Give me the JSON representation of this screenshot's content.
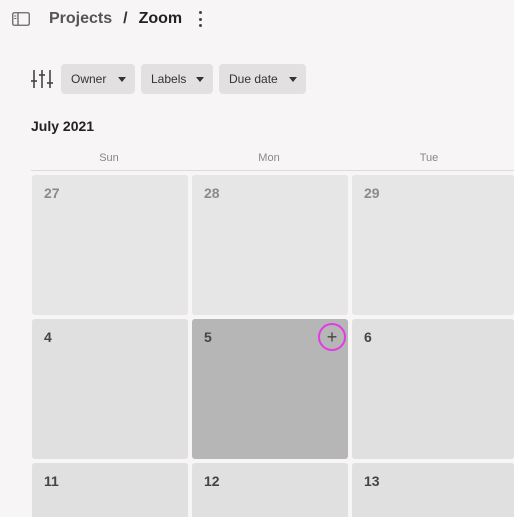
{
  "header": {
    "sidebar_icon": "sidebar-panel-icon",
    "breadcrumb": {
      "projects": "Projects",
      "separator": "/",
      "current": "Zoom"
    },
    "more_icon": "kebab-vertical-icon"
  },
  "filters": {
    "icon": "sliders-icon",
    "owner": "Owner",
    "labels": "Labels",
    "due_date": "Due date"
  },
  "calendar": {
    "month_label": "July 2021",
    "weekdays": [
      "Sun",
      "Mon",
      "Tue"
    ],
    "weeks": [
      [
        "27",
        "28",
        "29"
      ],
      [
        "4",
        "5",
        "6"
      ],
      [
        "11",
        "12",
        "13"
      ]
    ],
    "add_button_label": "+",
    "colors": {
      "hover_cell": "#b6b6b6",
      "add_ring": "#e23be2"
    }
  }
}
